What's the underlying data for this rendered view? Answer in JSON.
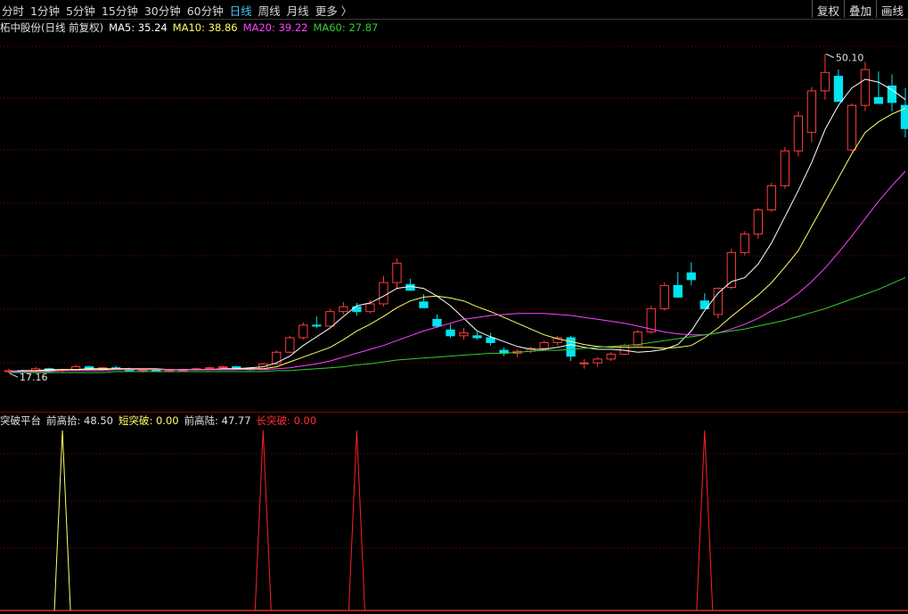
{
  "toolbar": {
    "tabs": [
      {
        "label": "分时",
        "active": false
      },
      {
        "label": "1分钟",
        "active": false
      },
      {
        "label": "5分钟",
        "active": false
      },
      {
        "label": "15分钟",
        "active": false
      },
      {
        "label": "30分钟",
        "active": false
      },
      {
        "label": "60分钟",
        "active": false
      },
      {
        "label": "日线",
        "active": true
      },
      {
        "label": "周线",
        "active": false
      },
      {
        "label": "月线",
        "active": false
      },
      {
        "label": "更多 〉",
        "active": false
      }
    ],
    "right_buttons": [
      "复权",
      "叠加",
      "画线"
    ]
  },
  "main_info": {
    "title": "柘中股份(日线 前复权)",
    "ma5": "MA5: 35.24",
    "ma10": "MA10: 38.86",
    "ma20": "MA20: 39.22",
    "ma60": "MA60: 27.87"
  },
  "indicator_info": {
    "name": "突破平台",
    "prev_high_pick": "前高拾: 48.50",
    "short_break": "短突破: 0.00",
    "prev_high_land": "前高陆: 47.77",
    "long_break": "长突破: 0.00"
  },
  "colors": {
    "up": "#ff3b3b",
    "down": "#00e5ee",
    "ma5": "#ffffff",
    "ma10": "#ffff66",
    "ma20": "#ff44ff",
    "ma60": "#33cc33",
    "short_break": "#ffff66",
    "long_break": "#ff2020",
    "grid": "#8b0000"
  },
  "chart_data": [
    {
      "type": "candlestick",
      "name": "price",
      "y_range": [
        15,
        52
      ],
      "annotations": [
        {
          "label": "50.10",
          "at": "high"
        },
        {
          "label": "17.16",
          "at": "low"
        }
      ],
      "candles": [
        [
          17.3,
          17.6,
          17.1,
          17.4
        ],
        [
          17.4,
          17.5,
          17.2,
          17.3
        ],
        [
          17.3,
          17.8,
          17.2,
          17.6
        ],
        [
          17.6,
          17.7,
          17.3,
          17.4
        ],
        [
          17.4,
          17.6,
          17.2,
          17.5
        ],
        [
          17.5,
          18.0,
          17.4,
          17.8
        ],
        [
          17.8,
          17.9,
          17.5,
          17.6
        ],
        [
          17.6,
          17.8,
          17.4,
          17.7
        ],
        [
          17.7,
          17.9,
          17.5,
          17.5
        ],
        [
          17.5,
          17.7,
          17.3,
          17.4
        ],
        [
          17.4,
          17.6,
          17.2,
          17.5
        ],
        [
          17.5,
          17.6,
          17.3,
          17.3
        ],
        [
          17.3,
          17.5,
          17.2,
          17.4
        ],
        [
          17.4,
          17.6,
          17.3,
          17.5
        ],
        [
          17.5,
          17.7,
          17.4,
          17.6
        ],
        [
          17.6,
          17.8,
          17.5,
          17.7
        ],
        [
          17.7,
          17.9,
          17.6,
          17.8
        ],
        [
          17.8,
          17.9,
          17.5,
          17.6
        ],
        [
          17.6,
          17.7,
          17.4,
          17.5
        ],
        [
          17.5,
          18.2,
          17.5,
          18.1
        ],
        [
          18.1,
          19.5,
          18.0,
          19.3
        ],
        [
          19.3,
          21.0,
          19.2,
          20.8
        ],
        [
          20.8,
          22.4,
          20.6,
          22.1
        ],
        [
          22.1,
          23.0,
          21.8,
          22.0
        ],
        [
          22.0,
          23.8,
          21.9,
          23.5
        ],
        [
          23.5,
          24.5,
          23.2,
          24.0
        ],
        [
          24.0,
          24.4,
          23.1,
          23.5
        ],
        [
          23.5,
          24.7,
          23.3,
          24.3
        ],
        [
          24.3,
          27.2,
          24.0,
          26.5
        ],
        [
          26.5,
          29.0,
          25.8,
          28.5
        ],
        [
          26.3,
          26.9,
          25.7,
          25.7
        ],
        [
          24.5,
          25.3,
          23.9,
          23.9
        ],
        [
          22.7,
          23.2,
          21.8,
          22.0
        ],
        [
          21.6,
          22.2,
          20.8,
          21.0
        ],
        [
          21.0,
          21.8,
          20.6,
          21.3
        ],
        [
          21.0,
          21.4,
          20.6,
          20.8
        ],
        [
          20.8,
          21.3,
          20.0,
          20.3
        ],
        [
          19.5,
          19.8,
          18.9,
          19.2
        ],
        [
          19.2,
          19.6,
          18.8,
          19.4
        ],
        [
          19.4,
          19.9,
          19.2,
          19.7
        ],
        [
          19.7,
          20.5,
          19.6,
          20.3
        ],
        [
          20.3,
          21.0,
          20.0,
          20.8
        ],
        [
          20.8,
          21.0,
          18.4,
          18.9
        ],
        [
          18.2,
          18.6,
          17.6,
          18.2
        ],
        [
          18.2,
          18.8,
          17.8,
          18.6
        ],
        [
          18.6,
          19.3,
          18.4,
          19.1
        ],
        [
          19.1,
          20.2,
          19.0,
          20.0
        ],
        [
          20.0,
          21.6,
          19.9,
          21.4
        ],
        [
          21.4,
          24.1,
          21.2,
          23.8
        ],
        [
          23.8,
          26.5,
          23.6,
          26.2
        ],
        [
          26.2,
          27.6,
          24.9,
          25.0
        ],
        [
          27.5,
          28.6,
          26.2,
          26.8
        ],
        [
          24.6,
          25.4,
          23.8,
          23.8
        ],
        [
          23.2,
          26.0,
          22.8,
          25.9
        ],
        [
          26.0,
          30.0,
          25.8,
          29.6
        ],
        [
          29.6,
          31.8,
          29.3,
          31.5
        ],
        [
          31.5,
          34.2,
          31.0,
          34.0
        ],
        [
          34.0,
          36.8,
          33.8,
          36.5
        ],
        [
          36.5,
          40.5,
          36.2,
          40.1
        ],
        [
          40.1,
          44.2,
          39.5,
          43.7
        ],
        [
          42.0,
          46.7,
          41.0,
          46.3
        ],
        [
          46.3,
          50.1,
          45.4,
          48.2
        ],
        [
          47.8,
          48.5,
          45.2,
          45.2
        ],
        [
          40.2,
          45.0,
          40.0,
          44.8
        ],
        [
          44.8,
          49.3,
          44.2,
          48.5
        ],
        [
          45.6,
          48.3,
          45.0,
          45.0
        ],
        [
          46.8,
          48.0,
          44.2,
          45.1
        ],
        [
          44.8,
          46.6,
          41.5,
          42.4
        ]
      ],
      "series": [
        {
          "name": "MA5",
          "values": [
            17.3,
            17.4,
            17.4,
            17.5,
            17.5,
            17.5,
            17.6,
            17.6,
            17.6,
            17.6,
            17.5,
            17.5,
            17.5,
            17.5,
            17.5,
            17.5,
            17.6,
            17.6,
            17.7,
            17.8,
            18.2,
            18.9,
            20.0,
            20.9,
            21.8,
            23.0,
            24.1,
            24.4,
            25.1,
            25.9,
            26.1,
            25.9,
            25.1,
            24.1,
            22.8,
            21.5,
            20.9,
            20.4,
            19.9,
            19.6,
            19.6,
            19.8,
            20.1,
            19.8,
            19.6,
            19.6,
            19.5,
            19.3,
            19.4,
            19.6,
            20.1,
            21.5,
            23.6,
            25.4,
            26.6,
            27.0,
            28.4,
            30.6,
            33.3,
            36.0,
            38.9,
            42.3,
            44.8,
            46.6,
            47.5,
            47.2,
            46.4,
            45.4
          ]
        },
        {
          "name": "MA10",
          "values": [
            17.3,
            17.3,
            17.4,
            17.4,
            17.5,
            17.5,
            17.5,
            17.5,
            17.6,
            17.6,
            17.6,
            17.6,
            17.5,
            17.5,
            17.5,
            17.5,
            17.5,
            17.5,
            17.6,
            17.6,
            17.8,
            18.3,
            18.8,
            19.3,
            19.8,
            20.6,
            21.5,
            22.2,
            23.0,
            23.9,
            24.6,
            25.0,
            25.1,
            24.9,
            24.6,
            24.0,
            23.5,
            22.9,
            22.3,
            21.7,
            21.1,
            20.7,
            20.4,
            20.1,
            19.9,
            19.8,
            19.8,
            19.8,
            19.8,
            19.7,
            19.8,
            20.0,
            20.8,
            21.8,
            23.0,
            24.1,
            25.2,
            26.5,
            28.1,
            29.8,
            32.3,
            34.8,
            37.3,
            39.8,
            42.0,
            43.1,
            43.9,
            44.5
          ]
        },
        {
          "name": "MA20",
          "values": [
            17.3,
            17.3,
            17.3,
            17.3,
            17.4,
            17.4,
            17.4,
            17.4,
            17.5,
            17.5,
            17.5,
            17.5,
            17.5,
            17.5,
            17.5,
            17.5,
            17.5,
            17.5,
            17.5,
            17.5,
            17.6,
            17.7,
            17.9,
            18.1,
            18.4,
            18.8,
            19.2,
            19.6,
            20.0,
            20.5,
            21.0,
            21.5,
            21.9,
            22.3,
            22.7,
            22.9,
            23.1,
            23.2,
            23.3,
            23.3,
            23.3,
            23.2,
            23.1,
            22.9,
            22.7,
            22.5,
            22.3,
            22.0,
            21.7,
            21.4,
            21.2,
            21.1,
            21.1,
            21.3,
            21.7,
            22.2,
            22.8,
            23.6,
            24.4,
            25.4,
            26.6,
            28.0,
            29.6,
            31.3,
            33.1,
            34.9,
            36.5,
            38.0
          ]
        },
        {
          "name": "MA60",
          "values": [
            17.2,
            17.2,
            17.2,
            17.2,
            17.2,
            17.2,
            17.2,
            17.2,
            17.3,
            17.3,
            17.3,
            17.3,
            17.3,
            17.3,
            17.3,
            17.3,
            17.3,
            17.3,
            17.3,
            17.3,
            17.4,
            17.4,
            17.5,
            17.6,
            17.7,
            17.8,
            18.0,
            18.1,
            18.3,
            18.5,
            18.6,
            18.7,
            18.8,
            18.9,
            19.0,
            19.1,
            19.2,
            19.2,
            19.3,
            19.4,
            19.5,
            19.5,
            19.6,
            19.7,
            19.8,
            19.9,
            20.0,
            20.1,
            20.3,
            20.5,
            20.7,
            20.9,
            21.1,
            21.3,
            21.5,
            21.7,
            22.0,
            22.3,
            22.6,
            23.0,
            23.4,
            23.8,
            24.3,
            24.8,
            25.3,
            25.8,
            26.4,
            27.0
          ]
        }
      ]
    },
    {
      "type": "line",
      "name": "indicator",
      "y_range": [
        0,
        1
      ],
      "series": [
        {
          "name": "短突破",
          "values": [
            0,
            0,
            0,
            0,
            1,
            0,
            0,
            0,
            0,
            0,
            0,
            0,
            0,
            0,
            0,
            0,
            0,
            0,
            0,
            0,
            0,
            0,
            0,
            0,
            0,
            0,
            0,
            0,
            0,
            0,
            0,
            0,
            0,
            0,
            0,
            0,
            0,
            0,
            0,
            0,
            0,
            0,
            0,
            0,
            0,
            0,
            0,
            0,
            0,
            0,
            0,
            0,
            0,
            0,
            0,
            0,
            0,
            0,
            0,
            0,
            0,
            0,
            0,
            0,
            0,
            0,
            0,
            0
          ]
        },
        {
          "name": "长突破",
          "values": [
            0,
            0,
            0,
            0,
            0,
            0,
            0,
            0,
            0,
            0,
            0,
            0,
            0,
            0,
            0,
            0,
            0,
            0,
            0,
            1,
            0,
            0,
            0,
            0,
            0,
            0,
            1,
            0,
            0,
            0,
            0,
            0,
            0,
            0,
            0,
            0,
            0,
            0,
            0,
            0,
            0,
            0,
            0,
            0,
            0,
            0,
            0,
            0,
            0,
            0,
            0,
            0,
            1,
            0,
            0,
            0,
            0,
            0,
            0,
            0,
            0,
            0,
            0,
            0,
            0,
            0,
            0,
            0
          ]
        }
      ]
    }
  ]
}
